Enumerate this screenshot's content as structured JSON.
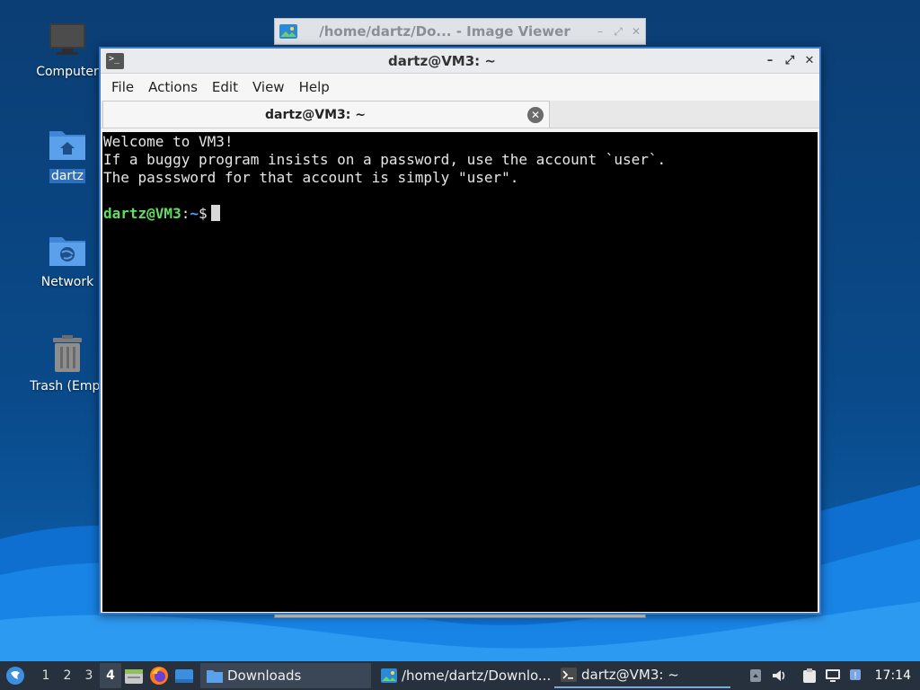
{
  "desktop": {
    "icons": [
      {
        "label": "Computer"
      },
      {
        "label": "dartz"
      },
      {
        "label": "Network"
      },
      {
        "label": "Trash (Empt"
      }
    ]
  },
  "image_viewer": {
    "title": "/home/dartz/Do... - Image Viewer"
  },
  "terminal": {
    "title": "dartz@VM3: ~",
    "menu": [
      "File",
      "Actions",
      "Edit",
      "View",
      "Help"
    ],
    "tab_title": "dartz@VM3: ~",
    "lines": [
      "Welcome to VM3!",
      "If a buggy program insists on a password, use the account `user`.",
      "The passsword for that account is simply \"user\"."
    ],
    "prompt": {
      "user_host": "dartz@VM3",
      "sep": ":",
      "path": "~",
      "symbol": "$"
    }
  },
  "taskbar": {
    "workspaces": [
      "1",
      "2",
      "3",
      "4"
    ],
    "active_workspace": "4",
    "tasks": [
      {
        "label": "Downloads"
      },
      {
        "label": "/home/dartz/Downlo..."
      },
      {
        "label": "dartz@VM3: ~"
      }
    ],
    "clock": "17:14"
  },
  "colors": {
    "prompt_user": "#5ee05e",
    "prompt_path": "#4aa0ff",
    "window_border": "#3a78c9",
    "taskbar_bg": "#27313d"
  }
}
